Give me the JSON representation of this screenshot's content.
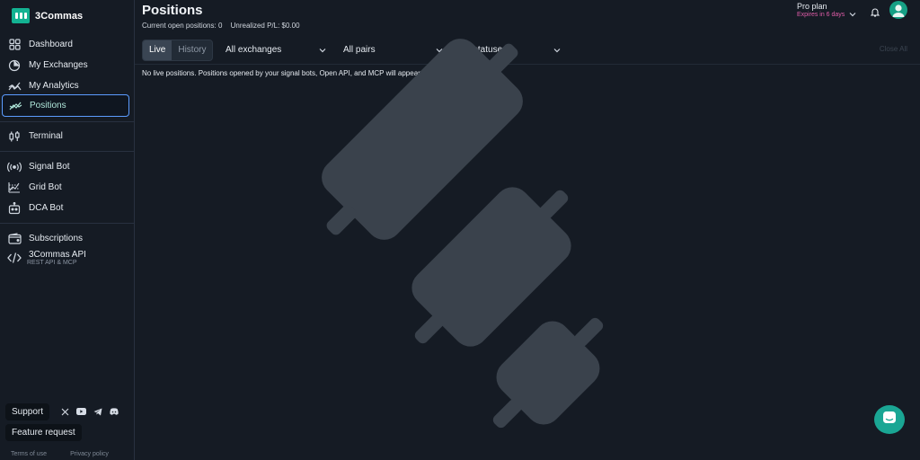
{
  "app": {
    "name": "3Commas"
  },
  "sidebar": {
    "items": [
      {
        "label": "Dashboard",
        "icon": "dashboard-icon"
      },
      {
        "label": "My Exchanges",
        "icon": "pie-chart-icon"
      },
      {
        "label": "My Analytics",
        "icon": "analytics-icon"
      },
      {
        "label": "Positions",
        "icon": "positions-icon",
        "active": true
      },
      {
        "label": "Terminal",
        "icon": "candles-icon"
      },
      {
        "label": "Signal Bot",
        "icon": "signal-icon"
      },
      {
        "label": "Grid Bot",
        "icon": "grid-icon"
      },
      {
        "label": "DCA Bot",
        "icon": "bot-icon"
      },
      {
        "label": "Subscriptions",
        "icon": "wallet-icon"
      },
      {
        "label": "3Commas API",
        "sublabel": "REST API & MCP",
        "icon": "code-icon"
      }
    ],
    "support_label": "Support",
    "feature_label": "Feature request",
    "socials": [
      "x-icon",
      "youtube-icon",
      "telegram-icon",
      "discord-icon"
    ],
    "footer": {
      "terms": "Terms of use",
      "privacy": "Privacy policy"
    }
  },
  "header": {
    "title": "Positions",
    "open_positions": "Current open positions: 0",
    "unrealized": "Unrealized P/L: $0.00",
    "plan_title": "Pro plan",
    "plan_sub": "Expires in 6 days"
  },
  "toolbar": {
    "tab_live": "Live",
    "tab_history": "History",
    "exchanges": "All exchanges",
    "pairs": "All pairs",
    "statuses": "All statuses",
    "close_all": "Close All"
  },
  "content": {
    "empty_message": "No live positions. Positions opened by your signal bots, Open API, and MCP will appear here."
  },
  "colors": {
    "accent": "#13b292",
    "active_border": "#5b9cff",
    "plan_expiry": "#e05ca8"
  }
}
